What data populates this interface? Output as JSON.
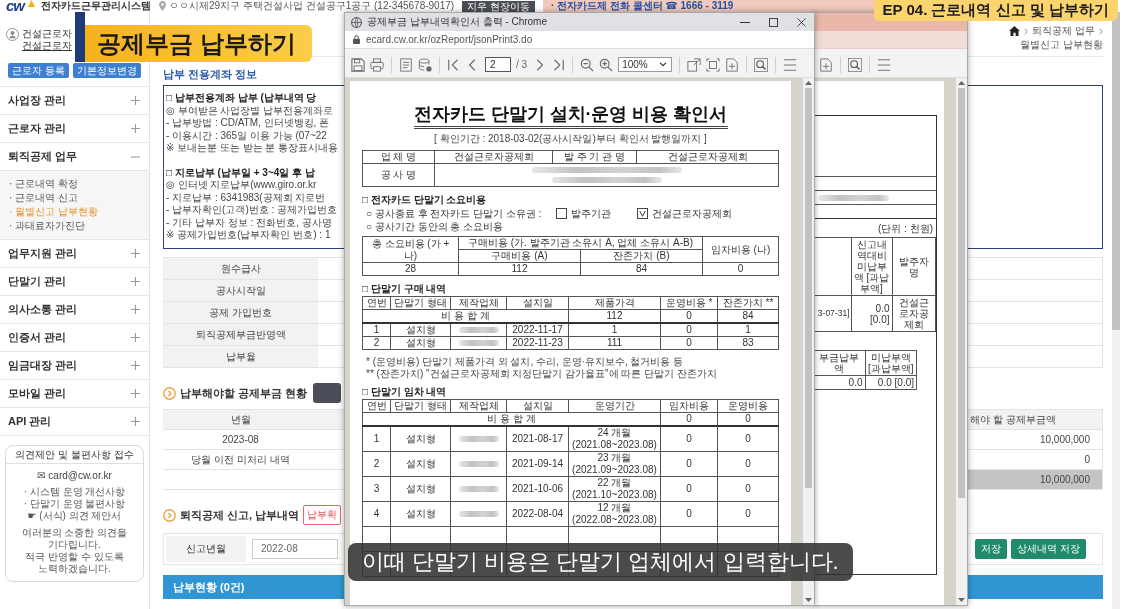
{
  "header": {
    "logo": "cw",
    "system_name": "전자카드근무관리시스템",
    "site": "ㅇㅇ시제29지구 주택건설사업 건설공구1공구 (12-345678-9017)",
    "site_button": "지우 현장이동",
    "hotline": "· 전자카드제 전화 콜센터 ☎ 1666 - 3119"
  },
  "overlays": {
    "title": "공제부금 납부하기",
    "episode": "EP 04. 근로내역 신고 및 납부하기",
    "subtitle": "이때 단말기 비용은 단말기 업체에서 입력합니다."
  },
  "sidebar": {
    "user": [
      "건설근로자",
      "건설근로자"
    ],
    "buttons": [
      "근로자 등록",
      "기본정보변경"
    ],
    "menu": [
      {
        "label": "사업장 관리",
        "expanded": false
      },
      {
        "label": "근로자 관리",
        "expanded": false
      },
      {
        "label": "퇴직공제 업무",
        "expanded": true,
        "children": [
          {
            "label": "· 근로내역 확정",
            "selected": false
          },
          {
            "label": "· 근로내역 신고",
            "selected": false
          },
          {
            "label": "· 월별신고 납부현황",
            "selected": true
          },
          {
            "label": "· 과태료자가진단",
            "selected": false
          }
        ]
      },
      {
        "label": "업무지원 관리",
        "expanded": false
      },
      {
        "label": "단말기 관리",
        "expanded": false
      },
      {
        "label": "의사소통 관리",
        "expanded": false
      },
      {
        "label": "인증서 관리",
        "expanded": false
      },
      {
        "label": "임금대장 관리",
        "expanded": false
      },
      {
        "label": "모바일 관리",
        "expanded": false
      },
      {
        "label": "API 관리",
        "expanded": false
      }
    ],
    "feedback": {
      "title": "의견제안 및 불편사항 접수",
      "email": "✉ card@cw.or.kr",
      "items": [
        "· 시스템 운영 개선사항",
        "· 단말기 운영 불편사항"
      ],
      "form_link": "☛ (서식) 의견 제안서",
      "message": [
        "여러분의 소중한 의견을 기다립니다.",
        "적극 반영할 수 있도록 노력하겠습니다."
      ]
    }
  },
  "breadcrumb": [
    "퇴직공제 업무",
    "월별신고 납부현황"
  ],
  "account_info": {
    "title": "납부 전용계좌 정보",
    "blocks": [
      [
        "□ 납부전용계좌 납부 (납부내역 당",
        "◎ 부여받은 사업장별 납부전용계좌로",
        "- 납부방법 : CD/ATM, 인터넷뱅킹, 폰",
        "- 이용시간 : 365일 이용 가능 (07~22",
        "※ 보내는분 또는 받는 분 통장표시내용"
      ],
      [
        "□ 지로납부 (납부일 + 3~4일 후 납",
        "◎ 인터넷 지로납부(www.giro.or.kr",
        "- 지로납부 : 6341983(공제회 지로번",
        "- 납부자확인(고객)번호 : 공제가입번호",
        "- 기타 납부자 정보 : 전화번호, 공사명",
        "※ 공제가입번호(납부자확인 번호) : 1"
      ]
    ]
  },
  "info_table": {
    "labels": [
      "원수급사",
      "공사시작일",
      "공제 가입번호",
      "퇴직공제부금반영액",
      "납부율"
    ]
  },
  "due_section": {
    "title": "납부해야할 공제부금 현황",
    "columns": [
      "년월",
      "해야 할 공제부금액"
    ],
    "rows": [
      {
        "period": "2023-08",
        "amount": "10,000,000",
        "total": false
      },
      {
        "period": "당월 이전 미처리 내역",
        "amount": "0",
        "total": false
      },
      {
        "amount": "10,000,000",
        "total": true
      }
    ]
  },
  "history_section": {
    "title": "퇴직공제 신고, 납부내역",
    "confirm_button": "납부확",
    "filter": {
      "label": "신고년월",
      "value": "2022-08"
    },
    "buttons": [
      "저장",
      "상세내역 저장"
    ],
    "status_bar": "납부현황 (0건)"
  },
  "print_window": {
    "title": "공제부금 납부내역확인서 출력 - Chrome",
    "url": "ecard.cw.or.kr/ozReport/jsonPrint3.do",
    "page": "2",
    "page_total": "/ 3",
    "zoom": "100%",
    "document": {
      "title": "전자카드 단말기 설치·운영 비용 확인서",
      "period": "[ 확인기간 : 2018-03-02(공사시작일)부터 확인서 발행일까지 ]",
      "summary": {
        "company_label": "업 체 명",
        "company": "건설근로자공제회",
        "client_label": "발 주 기 관 명",
        "client": "건설근로자공제회",
        "project_label": "공 사 명"
      },
      "cost_section": {
        "heading": "□ 전자카드 단말기 소요비용",
        "ownership_label": "○ 공사종료 후 전자카드 단말기 소유권 :",
        "owners": [
          {
            "label": "발주기관",
            "checked": false
          },
          {
            "label": "건설근로자공제회",
            "checked": true
          }
        ],
        "total_label": "○ 공사기간 동안의 총 소요비용",
        "table": {
          "total_header": "총 소요비용 (가 + 나)",
          "purchase_header": "구매비용 (가. 발주기관 소유시 A, 업체 소유시 A-B)",
          "purchase_sub": [
            "구매비용 (A)",
            "잔존가치 (B)"
          ],
          "lease_header": "임차비용 (나)",
          "values": [
            "28",
            "112",
            "84",
            "0"
          ]
        }
      },
      "purchase_section": {
        "heading": "□ 단말기 구매 내역",
        "columns": [
          "연번",
          "단말기 형태",
          "제작업체",
          "설치일",
          "제품가격",
          "운영비용 *",
          "잔존가치 **"
        ],
        "sum_label": "비 용 합 계",
        "sums": [
          "112",
          "0",
          "84"
        ],
        "rows": [
          {
            "no": "1",
            "form": "설치형",
            "installed": "2022-11-17",
            "price": "1",
            "operating": "0",
            "residual": "1"
          },
          {
            "no": "2",
            "form": "설치형",
            "installed": "2022-11-23",
            "price": "111",
            "operating": "0",
            "residual": "83"
          }
        ]
      },
      "notes": [
        "* (운영비용) 단말기 제품가격 외 설치, 수리, 운영·유지보수, 철거비용 등",
        "** (잔존가치) \"건설근로자공제회 지정단말기 감가율표\"에 따른 단말기 잔존가치"
      ],
      "lease_section": {
        "heading": "□ 단말기 임차 내역",
        "columns": [
          "연번",
          "단말기 형태",
          "제작업체",
          "설치일",
          "운영기간",
          "임차비용",
          "운영비용"
        ],
        "sum_label": "비 용 합 계",
        "sums": [
          "0",
          "0"
        ],
        "rows": [
          {
            "no": "1",
            "form": "설치형",
            "installed": "2021-08-17",
            "period": "24 개월 (2021.08~2023.08)",
            "lease": "0",
            "operating": "0"
          },
          {
            "no": "2",
            "form": "설치형",
            "installed": "2021-09-14",
            "period": "23 개월 (2021.09~2023.08)",
            "lease": "0",
            "operating": "0"
          },
          {
            "no": "3",
            "form": "설치형",
            "installed": "2021-10-06",
            "period": "22 개월 (2021.10~2023.08)",
            "lease": "0",
            "operating": "0"
          },
          {
            "no": "4",
            "form": "설치형",
            "installed": "2022-08-04",
            "period": "12 개월 (2022.08~2023.08)",
            "lease": "0",
            "operating": "0"
          }
        ]
      }
    }
  },
  "back_window": {
    "unit": "(단위 : 천원)",
    "table": {
      "columns": [
        "신고내역대비 미납부액 [과납부액]",
        "발주자명"
      ],
      "row": [
        "3-07-31]",
        "0.0 [0.0]",
        "건설근로자공제회"
      ]
    },
    "payment_table": {
      "columns": [
        "부금납부액",
        "미납부액 [과납부액]"
      ],
      "row": [
        "0.0",
        "0.0 [0.0]"
      ]
    }
  }
}
